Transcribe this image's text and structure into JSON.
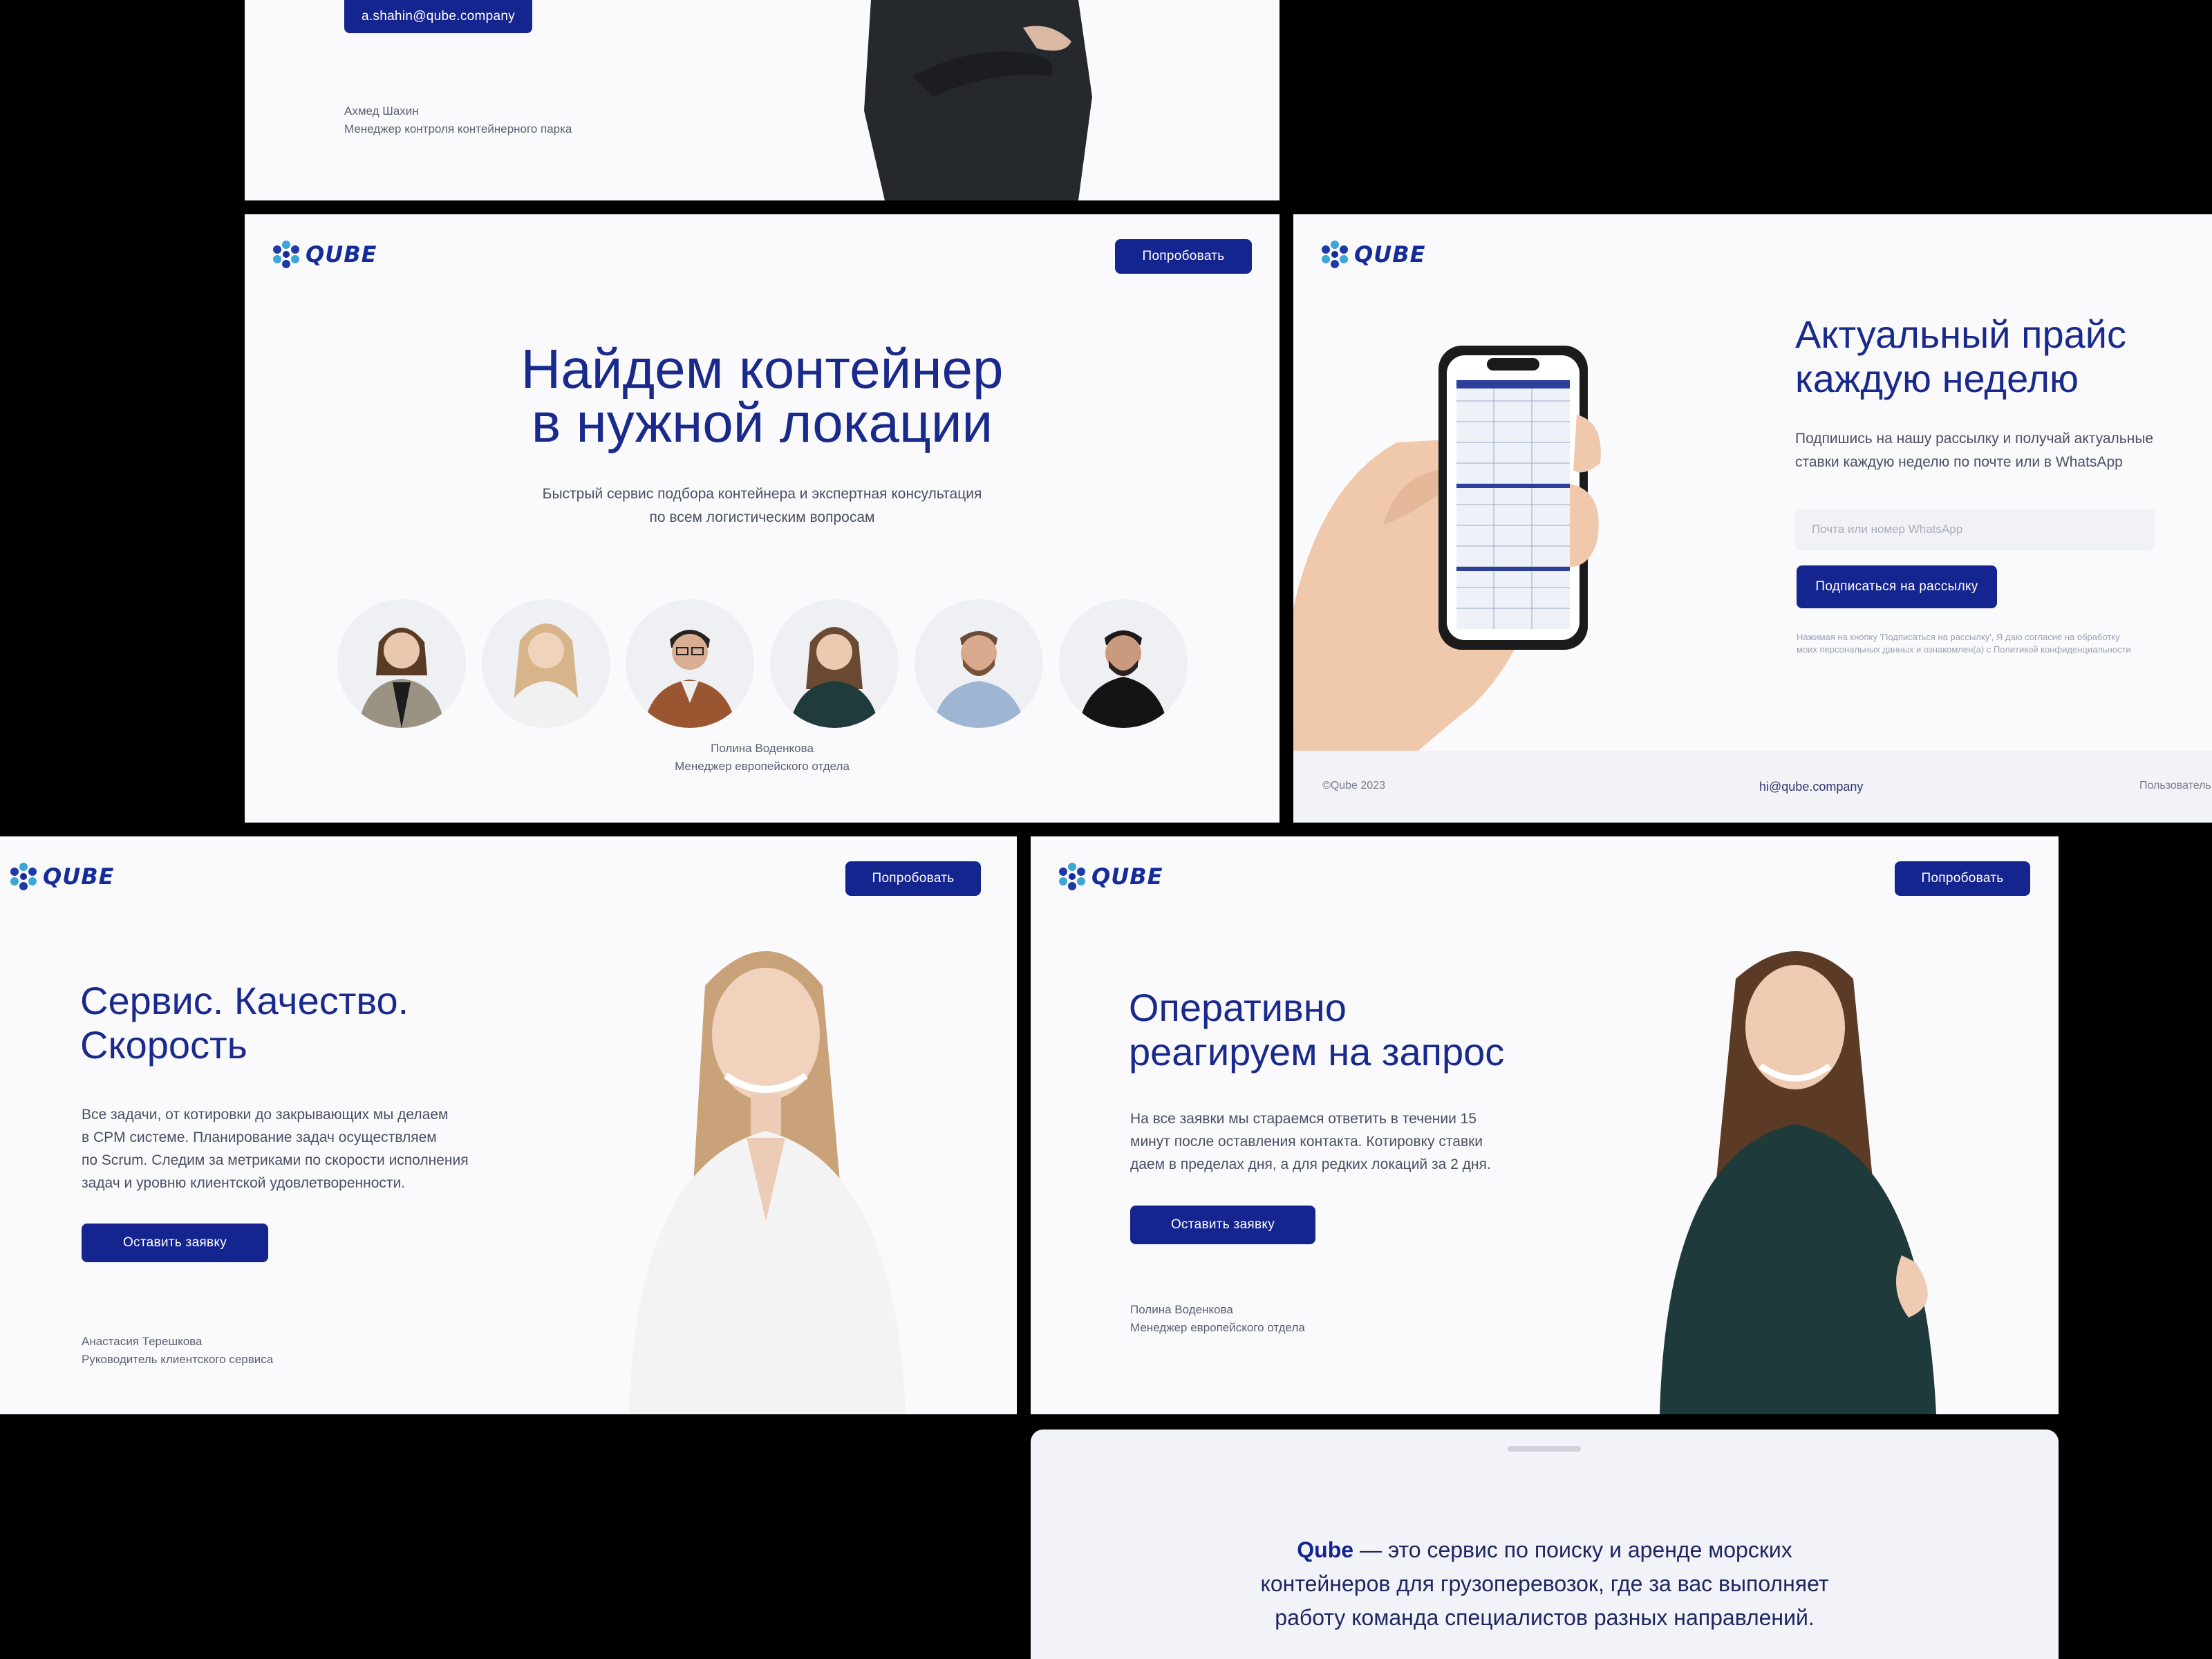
{
  "brand": {
    "name": "QUBE",
    "accent": "#15258f",
    "icon": "qube-hex-logo-icon"
  },
  "panel_top": {
    "email_button": "a.shahin@qube.company",
    "person_name": "Ахмед Шахин",
    "person_role": "Менеджер контроля контейнерного парка"
  },
  "panel_hero": {
    "try_button": "Попробовать",
    "title_line1": "Найдем контейнер",
    "title_line2": "в нужной локации",
    "subtitle_line1": "Быстрый сервис подбора контейнера и экспертная консультация",
    "subtitle_line2": "по всем логистическим вопросам",
    "selected_name": "Полина Воденкова",
    "selected_role": "Менеджер европейского отдела"
  },
  "panel_price": {
    "title_line1": "Актуальный прайс",
    "title_line2": "каждую неделю",
    "desc_line1": "Подпишись на нашу рассылку и получай актуальные",
    "desc_line2": "ставки каждую неделю по почте или в WhatsApp",
    "input_placeholder": "Почта или номер WhatsApp",
    "subscribe_button": "Подписаться на рассылку",
    "consent_line1": "Нажимая на кнопку 'Подписаться на рассылку', Я даю согласие на обработку",
    "consent_line2": "моих персональных данных и ознакомлен(а) с Политикой конфиденциальности",
    "footer_copyright": "©Qube 2023",
    "footer_email": "hi@qube.company",
    "footer_link": "Пользователь"
  },
  "panel_service": {
    "try_button": "Попробовать",
    "title_line1": "Сервис. Качество.",
    "title_line2": "Скорость",
    "desc_line1": "Все задачи, от котировки до закрывающих мы делаем",
    "desc_line2": "в CPM системе. Планирование задач осуществляем",
    "desc_line3": "по Scrum. Следим за метриками по скорости исполнения",
    "desc_line4": "задач и уровню клиентской удовлетворенности.",
    "cta_button": "Оставить заявку",
    "person_name": "Анастасия Терешкова",
    "person_role": "Руководитель клиентского сервиса"
  },
  "panel_fast": {
    "try_button": "Попробовать",
    "title_line1": "Оперативно",
    "title_line2": "реагируем на запрос",
    "desc_line1": "На все заявки мы стараемся ответить в течении 15",
    "desc_line2": "минут после оставления контакта. Котировку ставки",
    "desc_line3": "даем в пределах дня, а для редких локаций за 2 дня.",
    "cta_button": "Оставить заявку",
    "person_name": "Полина Воденкова",
    "person_role": "Менеджер европейского отдела"
  },
  "panel_about": {
    "brand_bold": "Qube",
    "line1_rest": " — это сервис по поиску и аренде морских",
    "line2": "контейнеров для грузоперевозок, где за вас выполняет",
    "line3": "работу команда специалистов разных направлений."
  }
}
